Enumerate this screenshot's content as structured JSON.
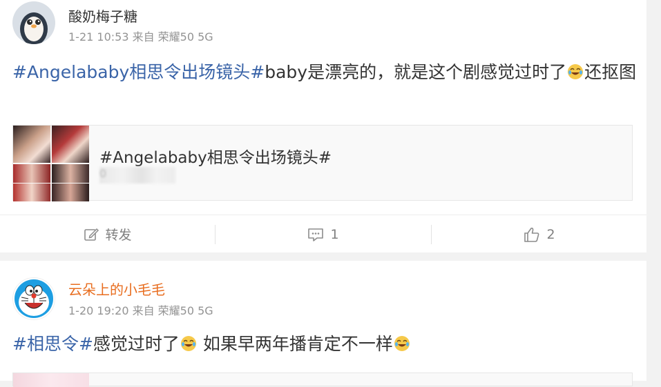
{
  "posts": [
    {
      "username": "酸奶梅子糖",
      "meta": "1-21 10:53 来自 荣耀50 5G",
      "content": {
        "hashtag": "#Angelababy相思令出场镜头#",
        "text_a": "baby是漂亮的，就是这个剧感觉过时了",
        "text_b": "还抠图"
      },
      "card": {
        "title": "#Angelababy相思令出场镜头#",
        "subtitle": "0"
      },
      "actions": {
        "repost": "转发",
        "comment_count": "1",
        "like_count": "2"
      }
    },
    {
      "username": "云朵上的小毛毛",
      "meta": "1-20 19:20 来自 荣耀50 5G",
      "content": {
        "hashtag": "#相思令#",
        "text_a": "感觉过时了",
        "text_b": "如果早两年播肯定不一样"
      }
    }
  ],
  "icons": {
    "repost": "edit-square-icon",
    "comment": "comment-icon",
    "like": "thumbs-up-icon",
    "emoji": "laugh-cry-emoji-icon"
  },
  "colors": {
    "hashtag": "#3a64a8",
    "username_highlight": "#e86d1f",
    "meta": "#939393"
  }
}
